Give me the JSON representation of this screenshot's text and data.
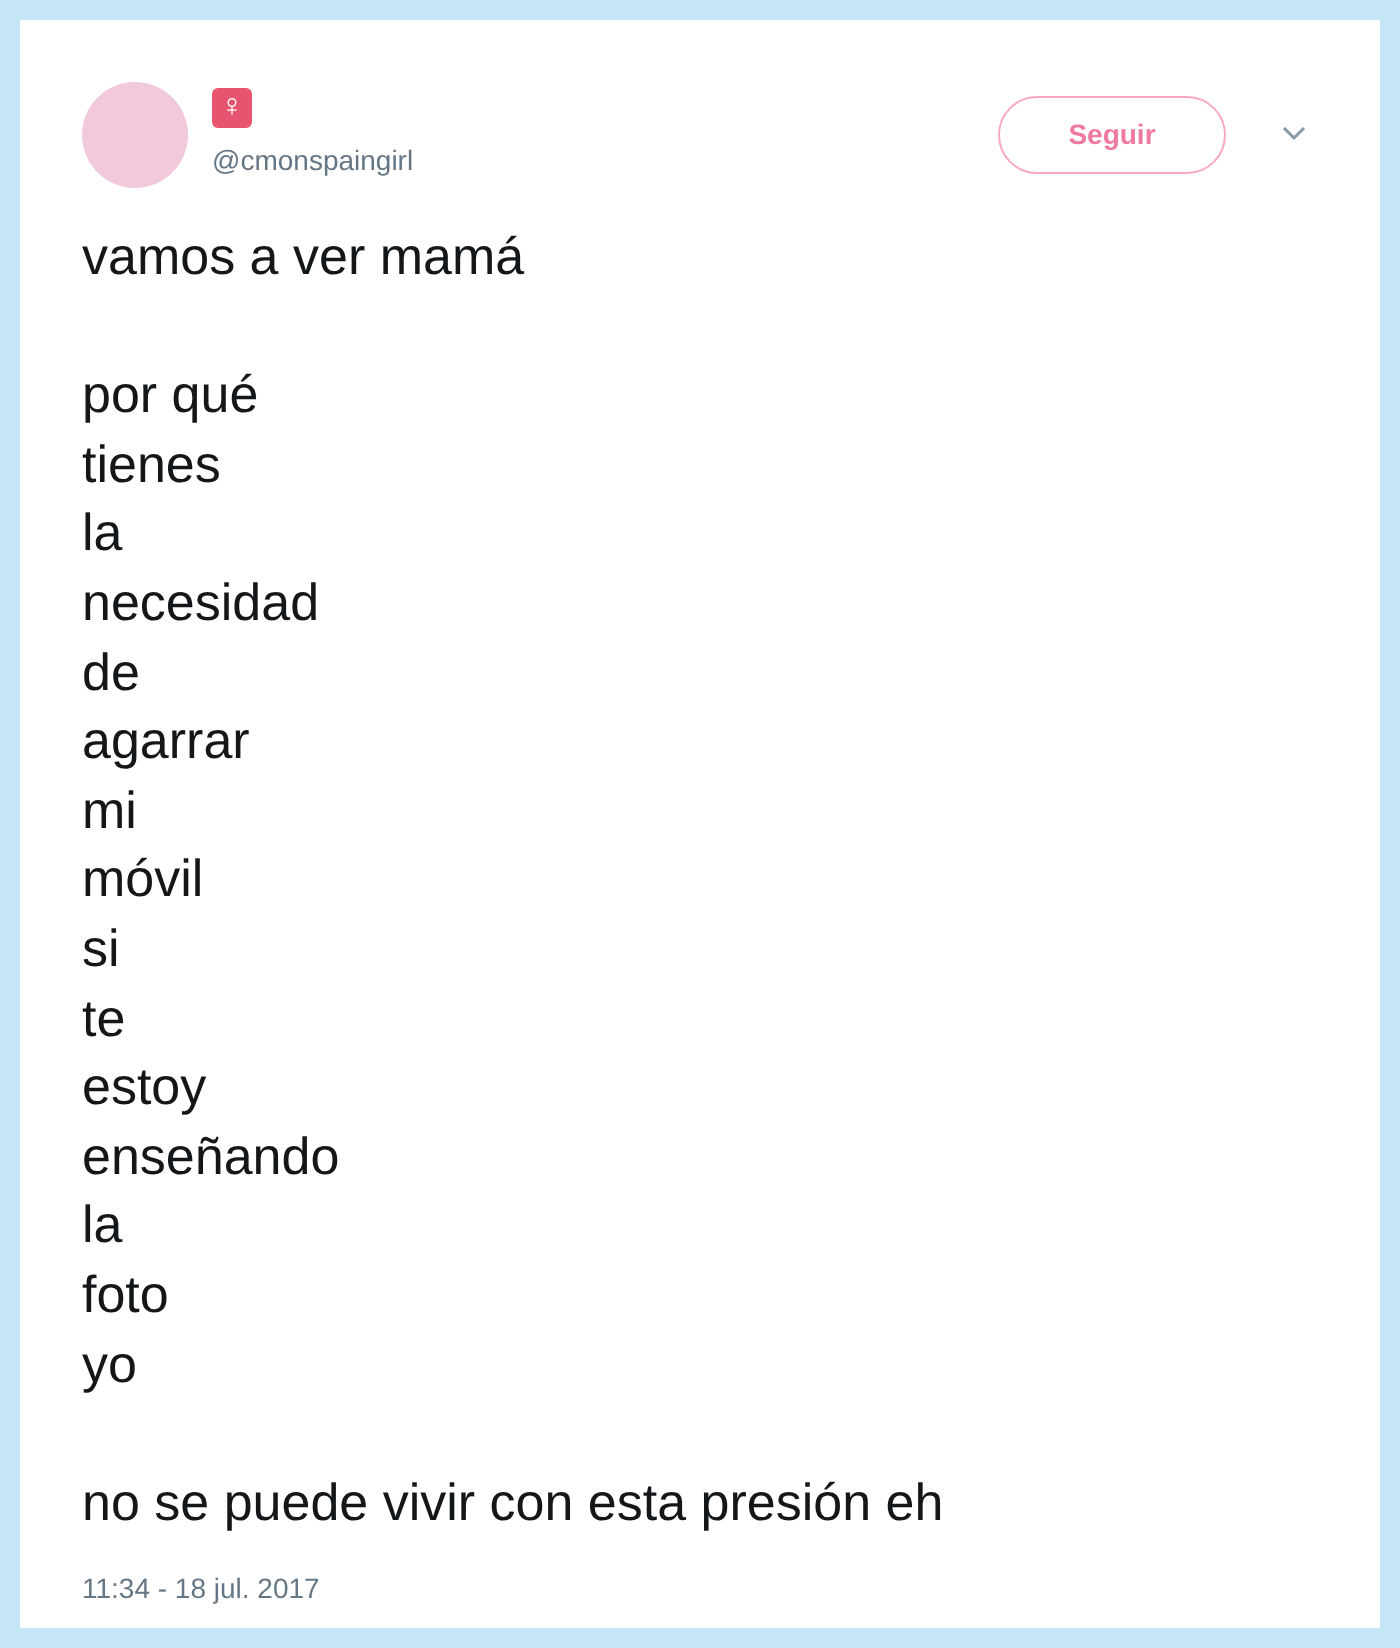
{
  "tweet": {
    "display_name": "♀",
    "handle": "@cmonspaingirl",
    "follow_button": "Seguir",
    "paragraphs": [
      [
        "vamos a ver mamá"
      ],
      [
        "por qué",
        "tienes",
        "la",
        "necesidad",
        "de",
        "agarrar",
        "mi",
        "móvil",
        "si",
        "te",
        "estoy",
        "enseñando",
        "la",
        "foto",
        "yo"
      ],
      [
        "no se puede vivir con esta presión eh"
      ]
    ],
    "timestamp": "11:34 - 18 jul. 2017"
  }
}
